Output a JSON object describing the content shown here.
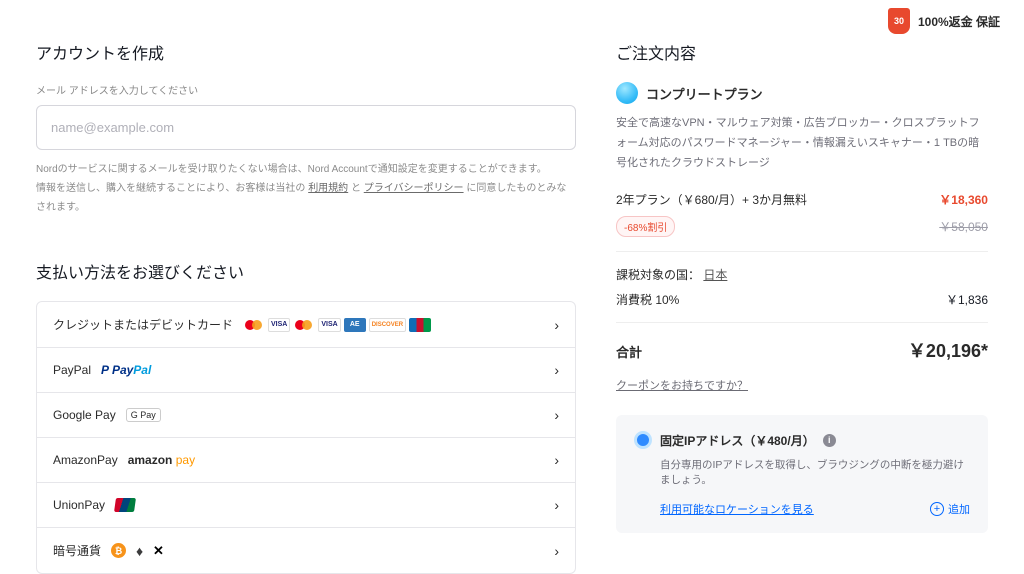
{
  "guarantee": {
    "days": "30",
    "text": "100%返金 保証"
  },
  "account": {
    "title": "アカウントを作成",
    "field_label": "メール アドレスを入力してください",
    "placeholder": "name@example.com",
    "disclaimer_line1": "Nordのサービスに関するメールを受け取りたくない場合は、Nord Accountで通知設定を変更することができます。",
    "disclaimer_prefix": "情報を送信し、購入を継続することにより、お客様は当社の",
    "terms_label": "利用規約",
    "and": "と",
    "privacy_label": "プライバシーポリシー",
    "disclaimer_suffix": "に同意したものとみなされます。"
  },
  "payment": {
    "title": "支払い方法をお選びください",
    "methods": [
      {
        "label": "クレジットまたはデビットカード"
      },
      {
        "label": "PayPal"
      },
      {
        "label": "Google Pay"
      },
      {
        "label": "AmazonPay"
      },
      {
        "label": "UnionPay"
      },
      {
        "label": "暗号通貨"
      }
    ],
    "gpay_text": "G Pay"
  },
  "order": {
    "title": "ご注文内容",
    "plan_name": "コンプリートプラン",
    "plan_desc": "安全で高速なVPN・マルウェア対策・広告ブロッカー・クロスプラットフォーム対応のパスワードマネージャー・情報漏えいスキャナー・1 TBの暗号化されたクラウドストレージ",
    "plan_term": "2年プラン（￥680/月）+ 3か月無料",
    "price_now": "￥18,360",
    "discount_badge": "-68%割引",
    "price_old": "￥58,050",
    "tax_country_label": "課税対象の国：",
    "tax_country": "日本",
    "tax_label": "消費税 10%",
    "tax_amount": "￥1,836",
    "total_label": "合計",
    "total_amount": "￥20,196*",
    "coupon_prompt": "クーポンをお持ちですか？"
  },
  "addon": {
    "title": "固定IPアドレス（￥480/月）",
    "desc": "自分専用のIPアドレスを取得し、ブラウジングの中断を極力避けましょう。",
    "locations_link": "利用可能なロケーションを見る",
    "add_label": "追加"
  }
}
